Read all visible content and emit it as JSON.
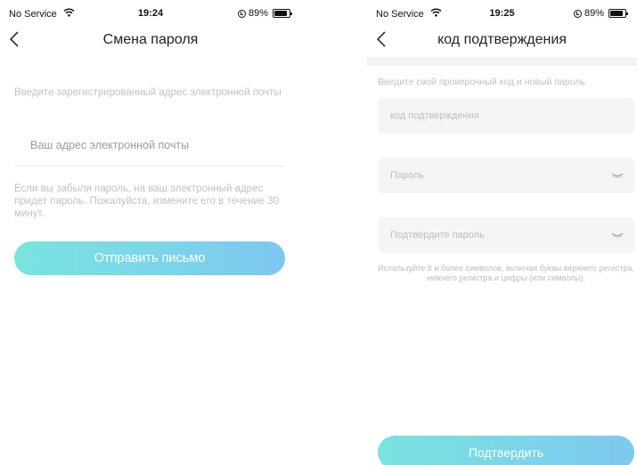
{
  "left_screen": {
    "status_bar": {
      "carrier": "No Service",
      "time": "19:24",
      "battery": "89%"
    },
    "title": "Смена пароля",
    "email_description": "Введите зарегистрированный адрес электронной почты",
    "email_input": {
      "placeholder": "Ваш адрес электронной почты",
      "value": ""
    },
    "hint": "Если вы забыли пароль, на ваш электронный адрес придет пароль. Пожалуйста, измените его в течение 30 минут.",
    "send_button_label": "Отправить письмо"
  },
  "right_screen": {
    "status_bar": {
      "carrier": "No Service",
      "time": "19:25",
      "battery": "89%"
    },
    "title": "код подтверждения",
    "instruction": "Введите свой проверочный код и новый пароль",
    "code_input": {
      "placeholder": "код подтверждения",
      "value": ""
    },
    "password_input": {
      "placeholder": "Пароль",
      "value": ""
    },
    "confirm_password_input": {
      "placeholder": "Подтвердите пароль",
      "value": ""
    },
    "requirements": "Используйте 8 и более символов, включая буквы верхнего регистра, нижнего регистра и цифры (или символы).",
    "confirm_button_label": "Подтвердить"
  },
  "colors": {
    "button_gradient_start": "#79e4e0",
    "button_gradient_end": "#7ec8f0",
    "field_background": "#f5f5f5"
  },
  "icons": {
    "back": "chevron-left-icon",
    "wifi": "wifi-icon",
    "battery": "battery-icon",
    "password_toggle": "eye-closed-icon"
  }
}
